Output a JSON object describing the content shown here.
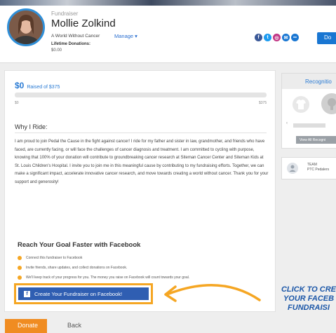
{
  "header": {
    "role": "Fundraiser",
    "name": "Mollie Zolkind",
    "org": "A World Without Cancer",
    "manage": "Manage ▾",
    "lifetime_label": "Lifetime Donations:",
    "lifetime_value": "$0.00",
    "donate": "Do",
    "socials": [
      {
        "icon": "facebook-icon",
        "glyph": "f",
        "color": "#3b5998"
      },
      {
        "icon": "twitter-icon",
        "glyph": "t",
        "color": "#1d9bf0"
      },
      {
        "icon": "instagram-icon",
        "glyph": "◎",
        "color": "#c13584"
      },
      {
        "icon": "email-icon",
        "glyph": "✉",
        "color": "#1976d2"
      },
      {
        "icon": "link-icon",
        "glyph": "∞",
        "color": "#1976d2"
      }
    ]
  },
  "progress": {
    "amount": "$0",
    "raised_label": "Raised of $375",
    "min": "$0",
    "max": "$375",
    "fraction": 0.0
  },
  "story": {
    "title": "Why I Ride:",
    "text": "I am proud to join Pedal the Cause in the fight against cancer! I ride for my father and sister in law, grandmother, and friends who have faced, are currently facing, or will face the challenges of cancer diagnosis and treatment. I am committed to cycling with purpose, knowing that 100% of your donation will contribute to groundbreaking cancer research at Siteman Cancer Center and Siteman Kids at St. Louis Children's Hospital. I invite you to join me in this meaningful cause by contributing to my fundraising efforts. Together, we can make a significant impact, accelerate innovative cancer research, and move towards creating a world without cancer. Thank you for your support and generosity!"
  },
  "facebook": {
    "title": "Reach Your Goal Faster with Facebook",
    "steps": [
      "Connect this fundraiser to Facebook",
      "Invite friends, share updates, and collect donations on Facebook.",
      "We'll keep track of your progress for you. The money you raise on Facebook will count towards your goal."
    ],
    "button_icon": "f",
    "button_label": "Create Your Fundraiser on Facebook!"
  },
  "recognition": {
    "title": "Recognitio",
    "view_all": "View All Recogni"
  },
  "team": {
    "label": "TEAM",
    "name": "PTC Pedalers"
  },
  "annotation": {
    "line1": "CLICK TO CRE",
    "line2": "YOUR FACEB",
    "line3": "FUNDRAISI"
  },
  "footer": {
    "donate": "Donate",
    "back": "Back"
  },
  "colors": {
    "accent_blue": "#2a7bd4",
    "facebook_blue": "#2f5eb2",
    "orange": "#f5a623",
    "donate_orange": "#f08c21"
  }
}
